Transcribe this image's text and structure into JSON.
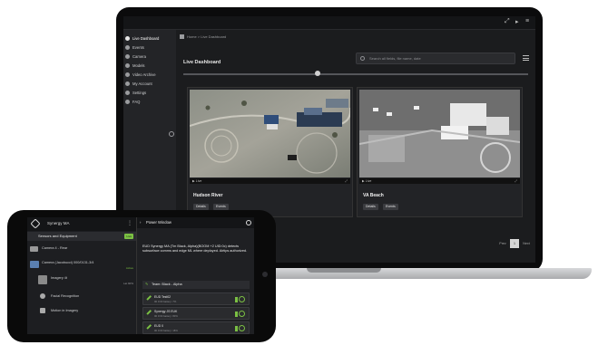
{
  "laptop": {
    "window_controls": [
      "⤢",
      "▸",
      "≡"
    ],
    "breadcrumb": {
      "home": "Home",
      "current": "Live Dashboard"
    },
    "sidebar": {
      "items": [
        {
          "label": "Live Dashboard",
          "active": true
        },
        {
          "label": "Events"
        },
        {
          "label": "Camera"
        },
        {
          "label": "Models"
        },
        {
          "label": "Video Archive"
        },
        {
          "label": "My Account"
        },
        {
          "label": "Settings"
        },
        {
          "label": "FAQ"
        }
      ]
    },
    "page_title": "Live Dashboard",
    "search": {
      "placeholder": "Search all fields, file name, date"
    },
    "cards": [
      {
        "name": "Hudson River",
        "live": "Live",
        "buttons": [
          "Details",
          "Events"
        ]
      },
      {
        "name": "VA Beach",
        "live": "Live",
        "buttons": [
          "Details",
          "Events"
        ]
      }
    ],
    "pagination": {
      "prev": "Prev",
      "page": "1",
      "next": "Next"
    }
  },
  "phone": {
    "app_title": "Synergy MA",
    "section": {
      "label": "Sensors and Equipment",
      "badge": "Live"
    },
    "rows": [
      {
        "label": "Camera 4 - Rear",
        "meta": ""
      },
      {
        "label": "Camera (Jacobucci) 000/0131-3/4",
        "meta": "Active"
      },
      {
        "label": "Imagery 4t",
        "meta": "Lat 90%"
      },
      {
        "label": "Facial Recognition",
        "meta": ""
      },
      {
        "label": "Motion in Imagery",
        "meta": ""
      }
    ],
    "power_window": {
      "title": "Power Window",
      "message": "EUD Synergy MA (Tm Black, Alpha)(BOOM +2 UID:0c) detects subsurface comms and edge ML where deployed. Airtips authorized.",
      "team": "Team: Black - Alpha",
      "units": [
        {
          "name": "EUD Test02",
          "status": "00 0:00 battery: 7%"
        },
        {
          "name": "Synergy JS EUK",
          "status": "00 0:00 battery: 80%"
        },
        {
          "name": "EUD 0",
          "status": "00 0:00 battery: 18%"
        }
      ]
    }
  }
}
